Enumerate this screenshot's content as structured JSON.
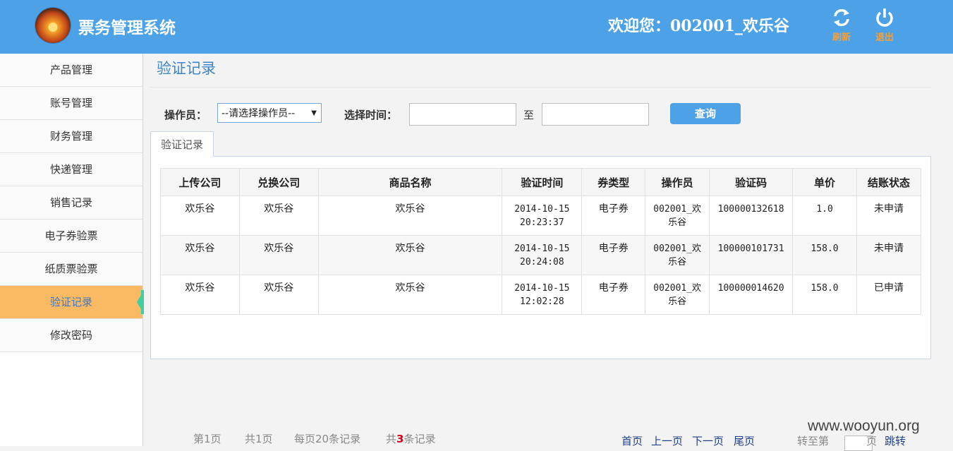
{
  "header": {
    "app_title": "票务管理系统",
    "welcome": "欢迎您：002001_欢乐谷",
    "refresh_label": "刷新",
    "logout_label": "退出"
  },
  "sidebar": {
    "items": [
      {
        "label": "产品管理"
      },
      {
        "label": "账号管理"
      },
      {
        "label": "财务管理"
      },
      {
        "label": "快递管理"
      },
      {
        "label": "销售记录"
      },
      {
        "label": "电子券验票"
      },
      {
        "label": "纸质票验票"
      },
      {
        "label": "验证记录",
        "active": true
      },
      {
        "label": "修改密码"
      }
    ]
  },
  "main": {
    "page_title": "验证记录",
    "filters": {
      "operator_label": "操作员：",
      "operator_value": "--请选择操作员--",
      "time_label": "选择时间：",
      "to_label": "至",
      "start_value": "",
      "end_value": "",
      "query_label": "查询"
    },
    "tab_label": "验证记录",
    "table": {
      "columns": [
        "上传公司",
        "兑换公司",
        "商品名称",
        "验证时间",
        "券类型",
        "操作员",
        "验证码",
        "单价",
        "结账状态"
      ],
      "rows": [
        [
          "欢乐谷",
          "欢乐谷",
          "欢乐谷",
          "2014-10-15 20:23:37",
          "电子券",
          "002001_欢乐谷",
          "100000132618",
          "1.0",
          "未申请"
        ],
        [
          "欢乐谷",
          "欢乐谷",
          "欢乐谷",
          "2014-10-15 20:24:08",
          "电子券",
          "002001_欢乐谷",
          "100000101731",
          "158.0",
          "未申请"
        ],
        [
          "欢乐谷",
          "欢乐谷",
          "欢乐谷",
          "2014-10-15 12:02:28",
          "电子券",
          "002001_欢乐谷",
          "100000014620",
          "158.0",
          "已申请"
        ]
      ]
    },
    "pager": {
      "current_page": "第1页",
      "total_pages": "共1页",
      "per_page": "每页20条记录",
      "total_prefix": "共",
      "total_count": "3",
      "total_suffix": "条记录",
      "first": "首页",
      "prev": "上一页",
      "next": "下一页",
      "last": "尾页",
      "goto_prefix": "转至第",
      "goto_value": "",
      "goto_suffix": "页",
      "goto_button": "跳转"
    }
  },
  "watermark": "www.wooyun.org",
  "colors": {
    "header_bg": "#4da1e6",
    "active_item_bg": "#fab963",
    "header_button_label": "#f5a13a",
    "accent_green": "#3ecfa0"
  }
}
